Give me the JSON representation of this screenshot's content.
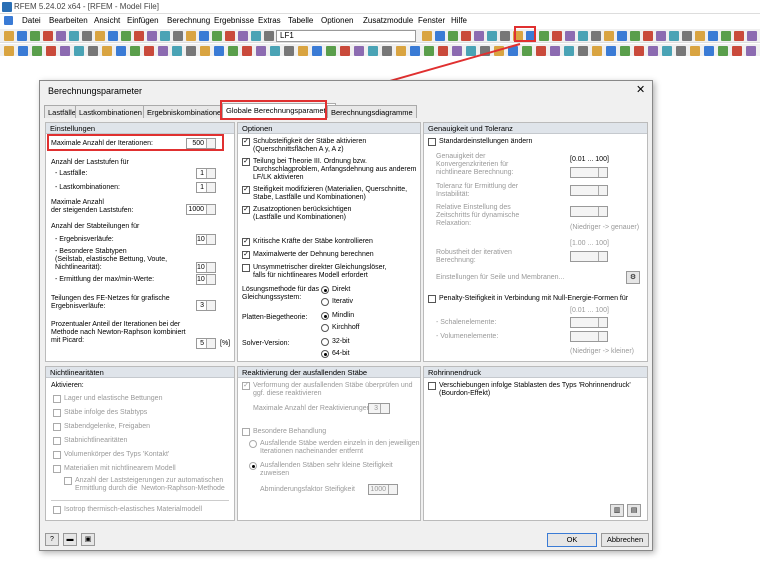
{
  "app": {
    "title": "RFEM 5.24.02 x64 - [RFEM - Model File]",
    "lf": "LF1"
  },
  "menu": [
    "Datei",
    "Bearbeiten",
    "Ansicht",
    "Einfügen",
    "Berechnung",
    "Ergebnisse",
    "Extras",
    "Tabelle",
    "Optionen",
    "Zusatzmodule",
    "Fenster",
    "Hilfe"
  ],
  "dialog": {
    "title": "Berechnungsparameter",
    "close": "✕",
    "tabs": [
      "Lastfälle",
      "Lastkombinationen",
      "Ergebniskombinationen",
      "Globale Berechnungsparameter",
      "Berechnungsdiagramme"
    ],
    "einstellungen": {
      "header": "Einstellungen",
      "max_iter_label": "Maximale Anzahl der Iterationen:",
      "max_iter": "500",
      "laststufen_label": "Anzahl der Laststufen für",
      "lastfaelle_label": "- Lastfälle:",
      "lastfaelle": "1",
      "lastkomb_label": "- Lastkombinationen:",
      "lastkomb": "1",
      "max_laststufen_label": "Maximale Anzahl\nder steigenden Laststufen:",
      "max_laststufen": "1000",
      "stabteilungen_label": "Anzahl der Stabteilungen für",
      "ergebnisverlaeufe_label": "- Ergebnisverläufe:",
      "ergebnisverlaeufe": "10",
      "besondere_label": "- Besondere Stabtypen\n(Seilstab, elastische Bettung, Voute,\nNichtlinearität):",
      "besondere": "10",
      "minmax_label": "- Ermittlung der max/min-Werte:",
      "minmax": "10",
      "fe_label": "Teilungen des FE-Netzes für grafische\nErgebnisverläufe:",
      "fe": "3",
      "prozent_label": "Prozentualer Anteil der Iterationen bei der\nMethode nach Newton-Raphson kombiniert\nmit Picard:",
      "prozent": "5",
      "prozent_unit": "[%]"
    },
    "optionen": {
      "header": "Optionen",
      "schub": "Schubsteifigkeit der Stäbe aktivieren\n(Querschnittsflächen A y, A z)",
      "teilung": "Teilung bei Theorie III. Ordnung bzw.\nDurchschlagproblem, Anfangsdehnung aus anderem\nLF/LK aktivieren",
      "steifigkeit": "Steifigkeit modifizieren (Materialien, Querschnitte,\nStabe, Lastfälle und Kombinationen)",
      "zusatz": "Zusatzoptionen berücksichtigen\n(Lastfälle und Kombinationen)",
      "kritisch": "Kritische Kräfte der Stäbe kontrollieren",
      "maxdehnung": "Maximalwerte der Dehnung berechnen",
      "unsym": "Unsymmetrischer direkter Gleichungslöser,\nfalls für nichtlineares Modell erfordert",
      "loesung_label": "Lösungsmethode für das\nGleichungssystem:",
      "direkt": "Direkt",
      "iterativ": "Iterativ",
      "platten_label": "Platten-Biegetheorie:",
      "mindlin": "Mindlin",
      "kirchhoff": "Kirchhoff",
      "solver_label": "Solver-Version:",
      "bit32": "32-bit",
      "bit64": "64-bit"
    },
    "genauigkeit": {
      "header": "Genauigkeit und Toleranz",
      "std": "Standardeinstellungen ändern",
      "konv": "Genauigkeit der\nKonvergenzkriterien für\nnichtlineare Berechnung:",
      "konv_range": "[0.01 ... 100]",
      "tol": "Toleranz für Ermittlung der\nInstabilität:",
      "relativ": "Relative Einstellung des\nZeitschritts für dynamische\nRelaxation:",
      "hint1": "(Niedriger -> genauer)",
      "robust_range": "[1.00 ... 100]",
      "robust": "Robustheit der iterativen\nBerechnung:",
      "seile": "Einstellungen für Seile und Membranen...",
      "penalty": "Penalty-Steifigkeit in Verbindung mit Null-Energie-Formen für",
      "pen_range": "[0.01 ... 100]",
      "schale": "- Schalenelemente:",
      "volumen": "- Volumenelemente:",
      "hint2": "(Niedriger -> kleiner)"
    },
    "nichtlin": {
      "header": "Nichtlinearitäten",
      "akt": "Aktivieren:",
      "items": [
        "Lager und elastische Bettungen",
        "Stäbe infolge des Stabtyps",
        "Stabendgelenke, Freigaben",
        "Stabnichtlinearitäten",
        "Volumenkörper des Typs 'Kontakt'",
        "Materialien mit nichtlinearem Modell"
      ],
      "sub": "Anzahl der Laststeigerungen zur automatischen\nErmittlung durch die  Newton-Raphson-Methode",
      "iso": "Isotrop thermisch-elastisches Materialmodell"
    },
    "reakt": {
      "header": "Reaktivierung der ausfallenden Stäbe",
      "verf": "Verformung der ausfallenden Stäbe überprüfen und\nggf. diese reaktivieren",
      "max_label": "Maximale Anzahl der Reaktivierungen:",
      "max": "3",
      "bes": "Besondere Behandlung",
      "r1": "Ausfallende Stäbe werden einzeln in den jeweiligen\nIterationen nacheinander entfernt",
      "r2": "Ausfallenden Stäben sehr kleine Steifigkeit\nzuweisen",
      "abm_label": "Abminderungsfaktor Steifigkeit",
      "abm": "1000"
    },
    "rohr": {
      "header": "Rohrinnendruck",
      "item": "Verschiebungen infolge Stablasten des Typs 'Rohrinnendruck'\n(Bourdon-Effekt)"
    },
    "ok": "OK",
    "cancel": "Abbrechen"
  }
}
